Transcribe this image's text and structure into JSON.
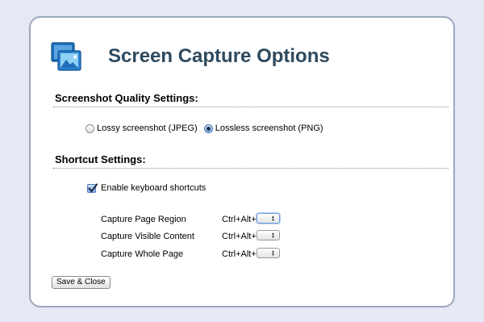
{
  "header": {
    "title": "Screen Capture Options",
    "icon": "screen-capture-app-icon"
  },
  "quality": {
    "heading": "Screenshot Quality Settings:",
    "options": [
      {
        "label": "Lossy screenshot (JPEG)",
        "selected": false
      },
      {
        "label": "Lossless screenshot (PNG)",
        "selected": true
      }
    ]
  },
  "shortcuts": {
    "heading": "Shortcut Settings:",
    "enable_label": "Enable keyboard shortcuts",
    "enabled": true,
    "rows": [
      {
        "label": "Capture Page Region",
        "prefix": "Ctrl+Alt+",
        "value": ""
      },
      {
        "label": "Capture Visible Content",
        "prefix": "Ctrl+Alt+",
        "value": ""
      },
      {
        "label": "Capture Whole Page",
        "prefix": "Ctrl+Alt+",
        "value": ""
      }
    ]
  },
  "footer": {
    "save_label": "Save & Close"
  },
  "colors": {
    "background": "#e6e9f5",
    "panel_border": "#9aa8bd",
    "title": "#2e4a5e",
    "accent": "#4d78b8"
  }
}
